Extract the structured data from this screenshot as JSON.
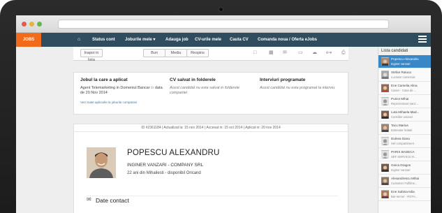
{
  "logo": {
    "text": "JOBS",
    "color": "#f26b1d"
  },
  "nav": {
    "items": [
      {
        "label": "Status cont"
      },
      {
        "label": "Joburile mele ▾"
      },
      {
        "label": "Adauga job"
      },
      {
        "label": "CV-urile mele"
      },
      {
        "label": "Cauta CV"
      },
      {
        "label": "Comanda noua / Oferta eJobs"
      }
    ],
    "bg_color": "#2f4d5f"
  },
  "toolbar": {
    "back_label": "Inapoi in lista",
    "bun_label": "Bun",
    "mediu_label": "Mediu",
    "respins_label": "Respins"
  },
  "info": {
    "job_title": "Jobul la care a aplicat",
    "job_text": "Agent Telemarketing in Domeniul Bancar",
    "job_in": "in",
    "job_date": "data de 20 Nov 2014",
    "job_link": "Vezi toate aplicarile la joburile companiei",
    "cv_title": "CV salvat in folderele",
    "cv_text": "Acest candidat nu este salvat in folderele companiei",
    "int_title": "Interviuri programate",
    "int_text": "Acest candidat nu este programat la interviu"
  },
  "profile": {
    "meta": "ID #2361184  |  Actualizat la: 15 nov 2014  |  Accesat in: 15 oct 2014  |  Aplicat in: 20 nov 2014",
    "name": "POPESCU ALEXANDRU",
    "position": "INGINER VANZARI - COMPANY SRL",
    "details": "22 ani din Mihailesti - disponibil Oricand",
    "contact_title": "Date contact"
  },
  "list": {
    "title": "Lista candidati",
    "items": [
      {
        "name": "Popescu Alexandru",
        "role": "Inginer vanzari"
      },
      {
        "name": "Stefan Raluca",
        "role": "Lucrator comercial"
      },
      {
        "name": "Ene Camelia Alina",
        "role": "Casier - Casa de ..."
      },
      {
        "name": "Purice Mihai",
        "role": "Reprezentant Vanz..."
      },
      {
        "name": "Luta Mihaela Mad...",
        "role": "Consilier vanzari"
      },
      {
        "name": "Tacu Marius",
        "role": "Estimator licitatii"
      },
      {
        "name": "Dulnea Dana",
        "role": "Sef compartiment"
      },
      {
        "name": "PARIS BADECA",
        "role": "SEF SERVICIU R..."
      },
      {
        "name": "Geica Dragos",
        "role": "Inginer vanzari"
      },
      {
        "name": "Alexandrescu Mihai",
        "role": "Customer Fulfilme..."
      },
      {
        "name": "Ene Sabina-Iulia",
        "role": "Bar-server - ROYA..."
      }
    ]
  }
}
